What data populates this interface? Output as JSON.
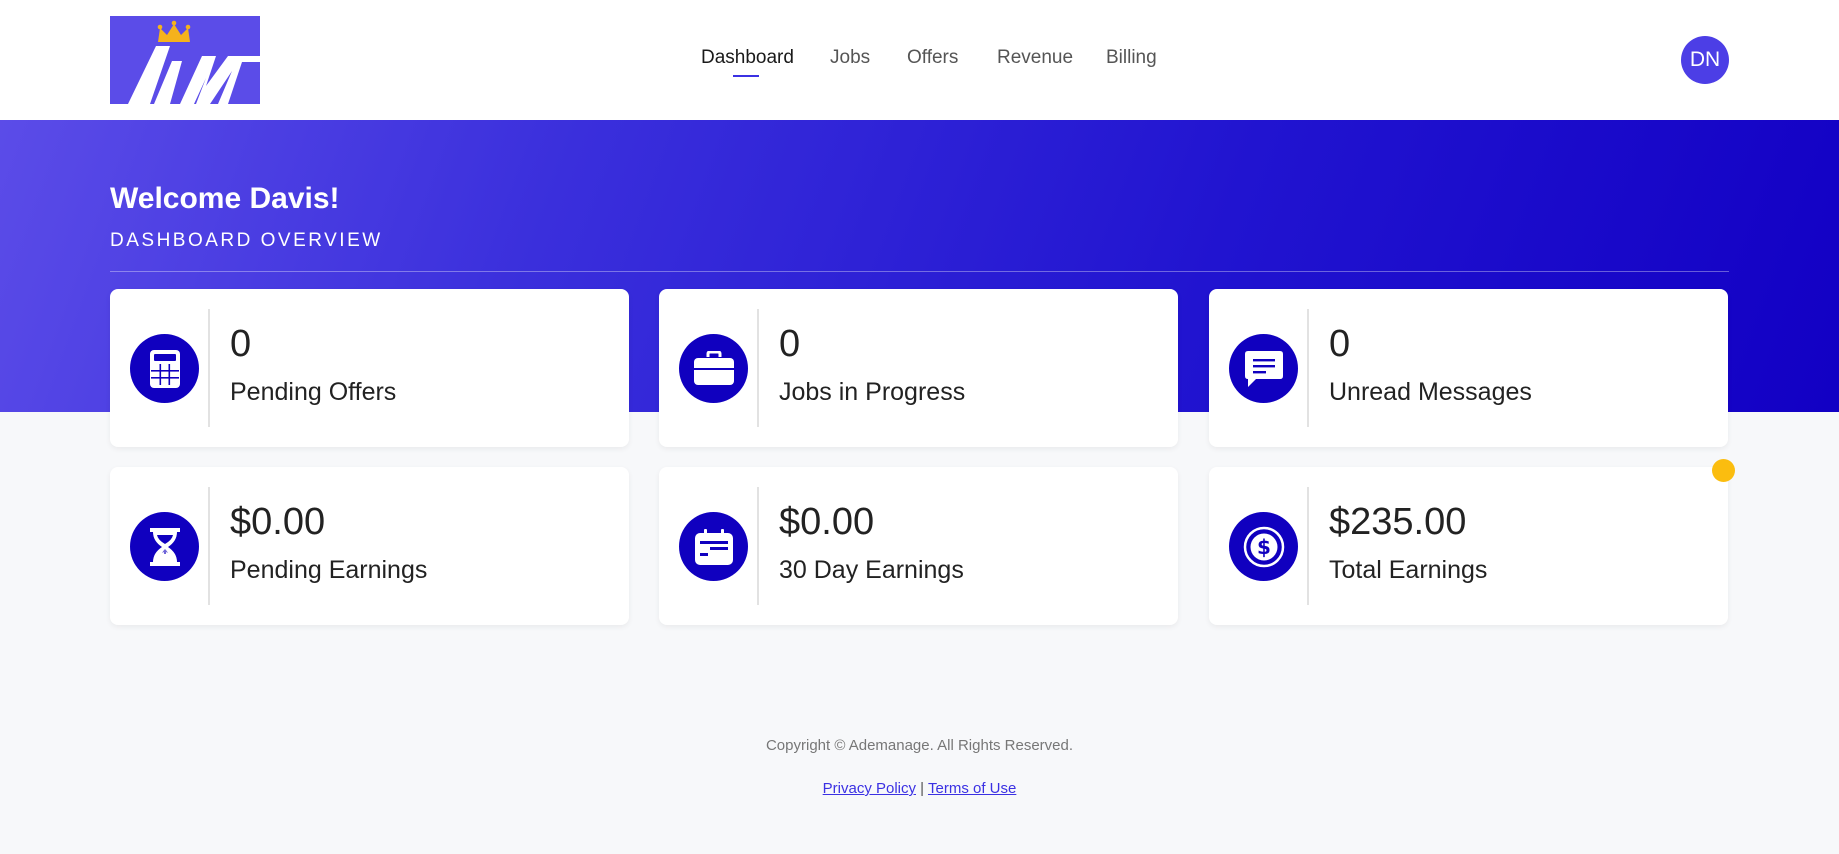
{
  "header": {
    "logo_alt": "AM",
    "nav": [
      {
        "label": "Dashboard",
        "active": true
      },
      {
        "label": "Jobs",
        "active": false
      },
      {
        "label": "Offers",
        "active": false
      },
      {
        "label": "Revenue",
        "active": false
      },
      {
        "label": "Billing",
        "active": false
      }
    ],
    "avatar_initials": "DN"
  },
  "hero": {
    "welcome": "Welcome Davis!",
    "subtitle": "DASHBOARD OVERVIEW"
  },
  "cards": [
    {
      "value": "0",
      "label": "Pending Offers",
      "icon": "calculator-icon"
    },
    {
      "value": "0",
      "label": "Jobs in Progress",
      "icon": "briefcase-icon"
    },
    {
      "value": "0",
      "label": "Unread Messages",
      "icon": "message-icon"
    },
    {
      "value": "$0.00",
      "label": "Pending Earnings",
      "icon": "hourglass-icon"
    },
    {
      "value": "$0.00",
      "label": "30 Day Earnings",
      "icon": "calendar-card-icon"
    },
    {
      "value": "$235.00",
      "label": "Total Earnings",
      "icon": "dollar-coin-icon"
    }
  ],
  "footer": {
    "copyright": "Copyright © Ademanage. All Rights Reserved.",
    "privacy": "Privacy Policy",
    "separator": "|",
    "terms": "Terms of Use"
  },
  "colors": {
    "accent": "#3b31e3",
    "icon_bg": "#1000bf",
    "notification": "#fbbd0f"
  }
}
